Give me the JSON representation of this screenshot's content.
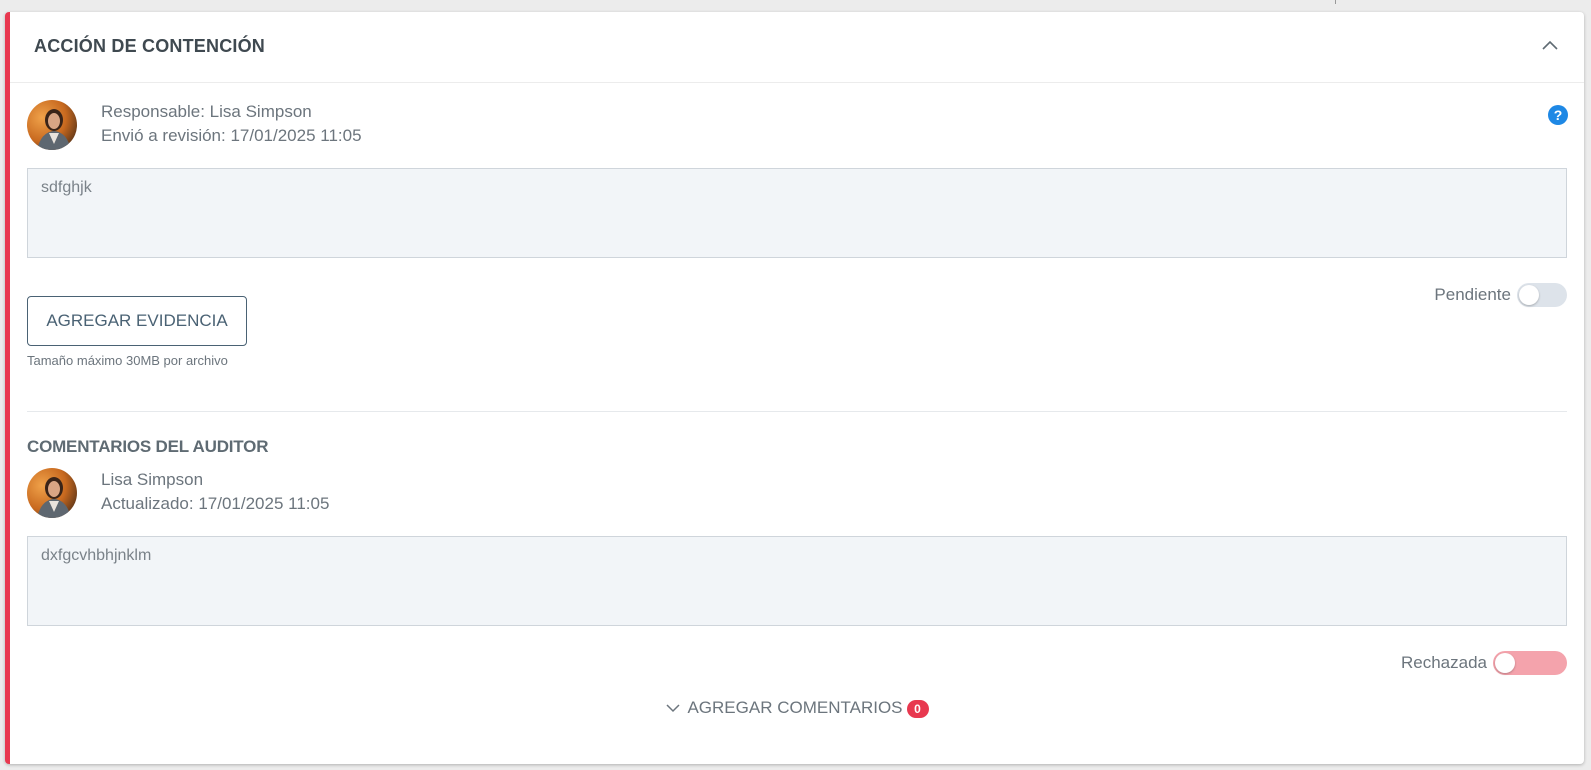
{
  "section": {
    "title": "ACCIÓN DE CONTENCIÓN"
  },
  "response": {
    "responsible": "Responsable: Lisa Simpson",
    "sent_review": "Envió a revisión: 17/01/2025 11:05",
    "text": "sdfghjk",
    "help_symbol": "?"
  },
  "evidence": {
    "button_label": "AGREGAR EVIDENCIA",
    "hint": "Tamaño máximo 30MB por archivo"
  },
  "status_toggle": {
    "label": "Pendiente",
    "on": false,
    "track_color": "#dde3ea"
  },
  "auditor": {
    "title": "COMENTARIOS DEL AUDITOR",
    "name": "Lisa Simpson",
    "updated": "Actualizado: 17/01/2025 11:05",
    "text": "dxfgcvhbhjnklm"
  },
  "rejected_toggle": {
    "label": "Rechazada",
    "on": false,
    "track_color": "#f4a3ac"
  },
  "comments": {
    "add_label": "AGREGAR COMENTARIOS",
    "count": "0"
  },
  "colors": {
    "accent_red": "#e8384f",
    "help_blue": "#1e88e5",
    "button_border": "#4a6274"
  }
}
